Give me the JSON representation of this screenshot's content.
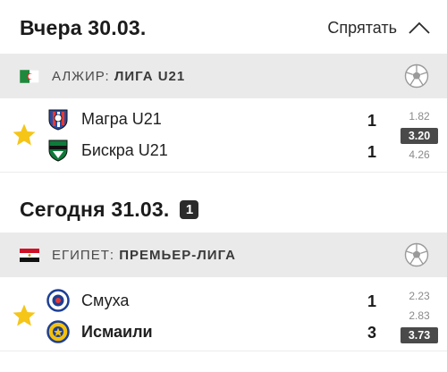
{
  "sections": [
    {
      "day_title": "Вчера 30.03.",
      "hide_label": "Спрятать",
      "league": {
        "country": "АЛЖИР: ",
        "name": "ЛИГА U21"
      },
      "match": {
        "home": {
          "name": "Магра U21",
          "score": "1",
          "bold": false
        },
        "away": {
          "name": "Бискра U21",
          "score": "1",
          "bold": false
        },
        "odds": [
          "1.82",
          "3.20",
          "4.26"
        ],
        "selected_odd_index": 1
      }
    },
    {
      "day_title": "Сегодня 31.03.",
      "badge_count": "1",
      "league": {
        "country": "ЕГИПЕТ: ",
        "name": "ПРЕМЬЕР-ЛИГА"
      },
      "match": {
        "home": {
          "name": "Смуха",
          "score": "1",
          "bold": false
        },
        "away": {
          "name": "Исмаили",
          "score": "3",
          "bold": true
        },
        "odds": [
          "2.23",
          "2.83",
          "3.73"
        ],
        "selected_odd_index": 2
      }
    }
  ],
  "icons": {
    "favorite": "star-icon",
    "sport": "football-icon",
    "collapse": "chevron-up-icon"
  },
  "colors": {
    "star": "#f5c518",
    "league_bar_bg": "#eaeaea",
    "selected_odd_bg": "#4a4a4a"
  }
}
